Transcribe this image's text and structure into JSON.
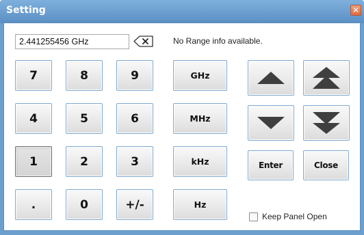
{
  "window": {
    "title": "Setting",
    "close_glyph": "✕"
  },
  "frequency": {
    "value": "2.441255456 GHz"
  },
  "range_info": "No Range info available.",
  "keypad": {
    "digits": [
      "7",
      "8",
      "9",
      "4",
      "5",
      "6",
      "1",
      "2",
      "3",
      ".",
      "0",
      "+/-"
    ],
    "pressed_key": "1"
  },
  "units": [
    "GHz",
    "MHz",
    "kHz",
    "Hz"
  ],
  "actions": {
    "enter": "Enter",
    "close": "Close"
  },
  "icons": {
    "backspace": "backspace-icon",
    "up_small": "arrow-up-icon",
    "up_large": "double-arrow-up-icon",
    "down_small": "arrow-down-icon",
    "down_large": "double-arrow-down-icon"
  },
  "keep_panel": {
    "label": "Keep Panel Open",
    "checked": false
  },
  "colors": {
    "titlebar": "#6c9fce",
    "button_border": "#7ea8cf",
    "arrow_fill": "#3f3f3f"
  }
}
